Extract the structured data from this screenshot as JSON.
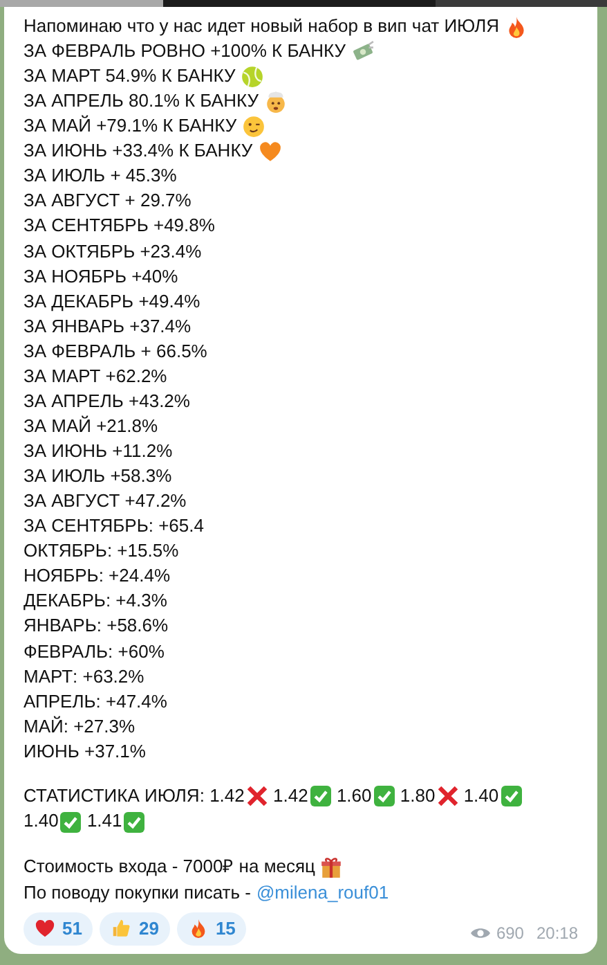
{
  "message": {
    "lines": [
      {
        "text": "Напоминаю что у нас идет новый набор в вип чат ИЮЛЯ",
        "kind": "fire"
      },
      {
        "text": "ЗА ФЕВРАЛЬ РОВНО +100% К БАНКУ",
        "kind": "money"
      },
      {
        "text": "ЗА МАРТ 54.9% К БАНКУ",
        "kind": "ball"
      },
      {
        "text": "ЗА АПРЕЛЬ 80.1% К БАНКУ",
        "kind": "mindblown"
      },
      {
        "text": "ЗА МАЙ +79.1% К БАНКУ",
        "kind": "wink"
      },
      {
        "text": "ЗА ИЮНЬ +33.4% К БАНКУ",
        "kind": "heart"
      },
      {
        "text": "ЗА ИЮЛЬ + 45.3%"
      },
      {
        "text": "ЗА АВГУСТ + 29.7%"
      },
      {
        "text": "ЗА СЕНТЯБРЬ +49.8%"
      },
      {
        "text": "ЗА ОКТЯБРЬ +23.4%"
      },
      {
        "text": "ЗА НОЯБРЬ +40%"
      },
      {
        "text": "ЗА ДЕКАБРЬ +49.4%"
      },
      {
        "text": "ЗА ЯНВАРЬ +37.4%"
      },
      {
        "text": "ЗА ФЕВРАЛЬ + 66.5%"
      },
      {
        "text": "ЗА МАРТ +62.2%"
      },
      {
        "text": "ЗА АПРЕЛЬ +43.2%"
      },
      {
        "text": "ЗА МАЙ +21.8%"
      },
      {
        "text": "ЗА ИЮНЬ +11.2%"
      },
      {
        "text": "ЗА ИЮЛЬ +58.3%"
      },
      {
        "text": "ЗА АВГУСТ +47.2%"
      },
      {
        "text": "ЗА СЕНТЯБРЬ: +65.4"
      },
      {
        "text": "ОКТЯБРЬ: +15.5%"
      },
      {
        "text": "НОЯБРЬ: +24.4%"
      },
      {
        "text": "ДЕКАБРЬ: +4.3%"
      },
      {
        "text": "ЯНВАРЬ: +58.6%"
      },
      {
        "text": "ФЕВРАЛЬ: +60%"
      },
      {
        "text": "МАРТ: +63.2%"
      },
      {
        "text": "АПРЕЛЬ: +47.4%"
      },
      {
        "text": "МАЙ: +27.3%"
      },
      {
        "text": "ИЮНЬ +37.1%"
      }
    ],
    "stats_label": "СТАТИСТИКА ИЮЛЯ:",
    "stats": [
      {
        "value": "1.42",
        "kind": "loss"
      },
      {
        "value": "1.42",
        "kind": "win"
      },
      {
        "value": "1.60",
        "kind": "win"
      },
      {
        "value": "1.80",
        "kind": "loss"
      },
      {
        "value": "1.40",
        "kind": "win"
      },
      {
        "value": "1.40",
        "kind": "win"
      },
      {
        "value": "1.41",
        "kind": "win"
      }
    ],
    "price": {
      "text": "Стоимость входа - 7000₽ на месяц",
      "kind": "gift"
    },
    "contact": {
      "text": "По поводу покупки писать -",
      "link": "@milena_rouf01"
    },
    "reactions": [
      {
        "kind": "heart",
        "count": "51"
      },
      {
        "kind": "thumb",
        "count": "29"
      },
      {
        "kind": "fire",
        "count": "15"
      }
    ],
    "views": "690",
    "time": "20:18"
  }
}
